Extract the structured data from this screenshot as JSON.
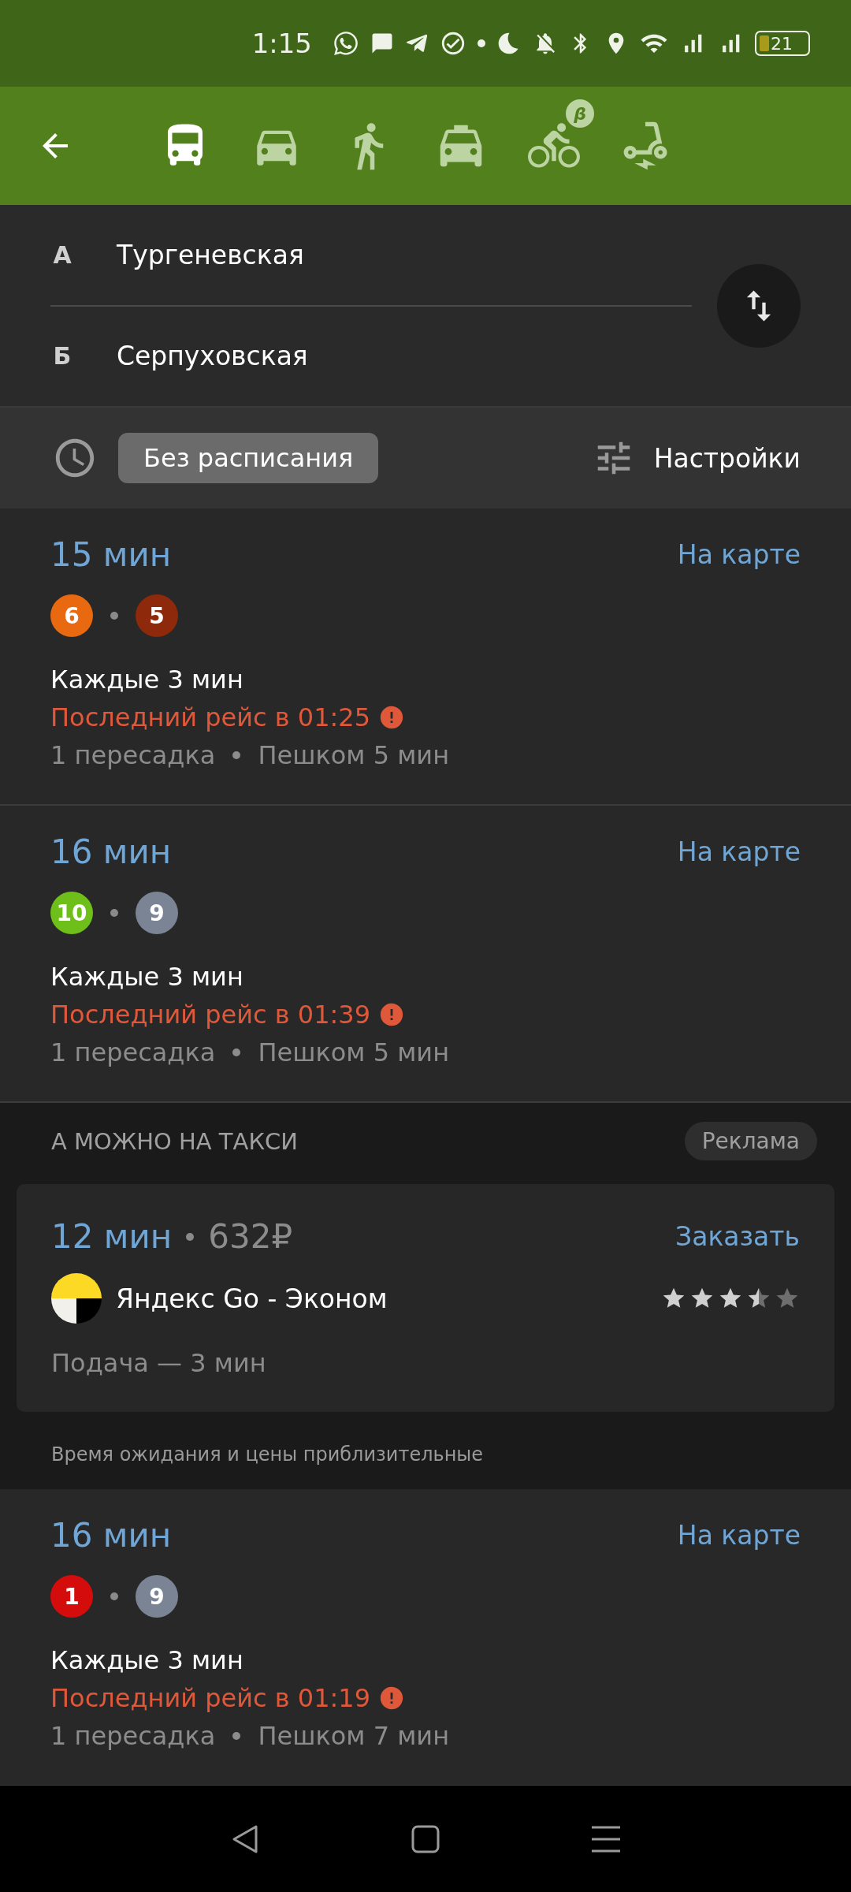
{
  "status_bar": {
    "time": "1:15",
    "battery": "21"
  },
  "header": {
    "modes": [
      {
        "kind": "bus",
        "selected": true
      },
      {
        "kind": "car",
        "selected": false
      },
      {
        "kind": "walk",
        "selected": false
      },
      {
        "kind": "taxi",
        "selected": false
      },
      {
        "kind": "bike",
        "selected": false,
        "badge": "β"
      },
      {
        "kind": "scooter",
        "selected": false
      }
    ]
  },
  "route": {
    "from": {
      "marker": "А",
      "value": "Тургеневская"
    },
    "to": {
      "marker": "Б",
      "value": "Серпуховская"
    }
  },
  "filters": {
    "schedule_chip": "Без расписания",
    "settings": "Настройки"
  },
  "items": [
    {
      "kind": "route",
      "duration": "15 мин",
      "map_link": "На карте",
      "lines": [
        {
          "number": "6",
          "color": "#e8690f"
        },
        {
          "number": "5",
          "color": "#8e2a0b"
        }
      ],
      "frequency": "Каждые 3 мин",
      "last_trip": "Последний рейс в 01:25",
      "transfers": "1 пересадка",
      "walk": "Пешком 5 мин"
    },
    {
      "kind": "route",
      "duration": "16 мин",
      "map_link": "На карте",
      "lines": [
        {
          "number": "10",
          "color": "#6fbf1a"
        },
        {
          "number": "9",
          "color": "#7a8494"
        }
      ],
      "frequency": "Каждые 3 мин",
      "last_trip": "Последний рейс в 01:39",
      "transfers": "1 пересадка",
      "walk": "Пешком 5 мин"
    },
    {
      "kind": "taxi",
      "section_title": "А МОЖНО НА ТАКСИ",
      "ad_label": "Реклама",
      "duration": "12 мин",
      "price": "632₽",
      "action": "Заказать",
      "provider": "Яндекс Go - Эконом",
      "stars": 3.5,
      "pickup": "Подача — 3 мин",
      "note": "Время ожидания и цены приблизительные"
    },
    {
      "kind": "route",
      "duration": "16 мин",
      "map_link": "На карте",
      "lines": [
        {
          "number": "1",
          "color": "#d40c0c"
        },
        {
          "number": "9",
          "color": "#7a8494"
        }
      ],
      "frequency": "Каждые 3 мин",
      "last_trip": "Последний рейс в 01:19",
      "transfers": "1 пересадка",
      "walk": "Пешком 7 мин"
    }
  ]
}
